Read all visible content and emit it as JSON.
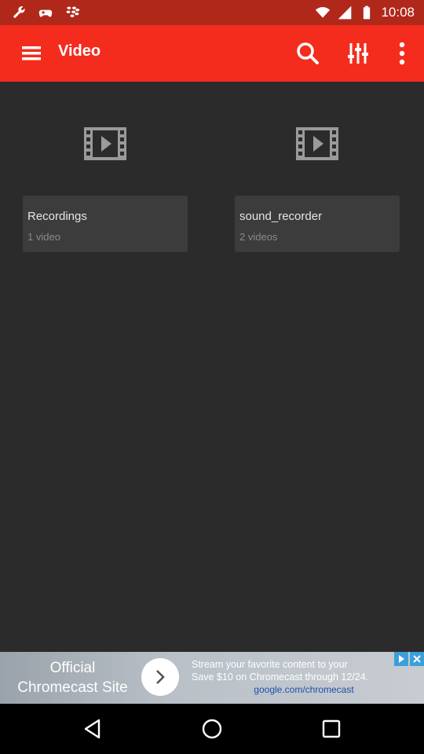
{
  "status_bar": {
    "time": "10:08",
    "icons": [
      "wrench-icon",
      "gamepad-icon",
      "blackberry-icon",
      "wifi-icon",
      "signal-icon",
      "battery-icon"
    ]
  },
  "app_bar": {
    "title": "Video",
    "actions": [
      "menu-icon",
      "search-icon",
      "equalizer-icon",
      "more-vert-icon"
    ],
    "background": "#f32c1e"
  },
  "folders": [
    {
      "name": "Recordings",
      "count": "1 video"
    },
    {
      "name": "sound_recorder",
      "count": "2 videos"
    }
  ],
  "ad": {
    "title_line1": "Official",
    "title_line2": "Chromecast Site",
    "body_line1": "Stream your favorite content to your",
    "body_line2": "Save $10 on Chromecast through 12/24.",
    "link": "google.com/chromecast"
  },
  "nav_bar": {
    "buttons": [
      "back-icon",
      "home-icon",
      "recents-icon"
    ]
  },
  "colors": {
    "status_bar": "#b0281a",
    "content_bg": "#2b2b2b",
    "card_bg": "#3c3c3c"
  }
}
